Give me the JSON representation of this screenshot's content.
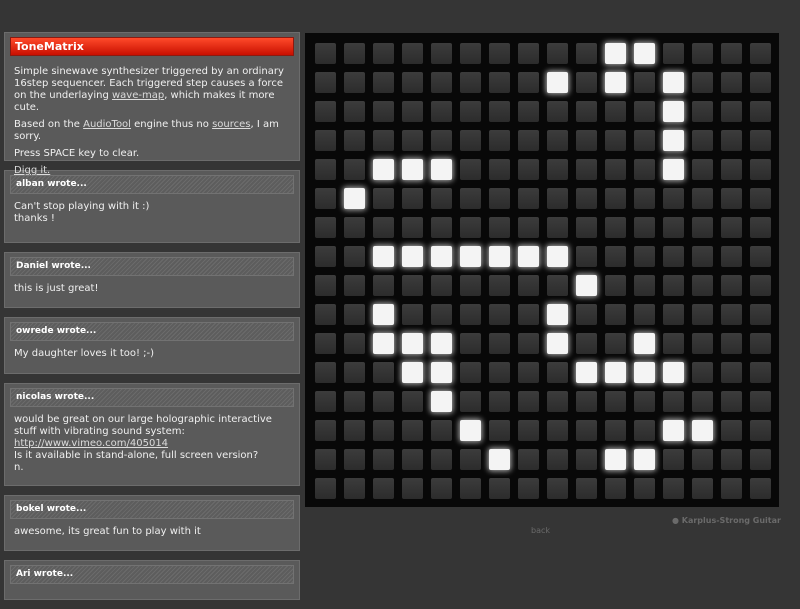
{
  "intro": {
    "title": "ToneMatrix",
    "line1_a": "Simple sinewave synthesizer triggered by an ordinary 16step sequencer. Each triggered step causes a force on the underlaying ",
    "line1_link": "wave-map",
    "line1_b": ", which makes it more cute.",
    "line2_a": "Based on the ",
    "line2_link1": "AudioTool",
    "line2_b": " engine thus no ",
    "line2_link2": "sources",
    "line2_c": ", I am sorry.",
    "line3": "Press SPACE key to clear.",
    "digg": "Digg it."
  },
  "comments": [
    {
      "author": "alban wrote...",
      "lines": [
        "Can't stop playing with it :)",
        "thanks !"
      ]
    },
    {
      "author": "Daniel wrote...",
      "lines": [
        "this is just great!"
      ]
    },
    {
      "author": "owrede wrote...",
      "lines": [
        "My daughter loves it too! ;-)"
      ]
    },
    {
      "author": "nicolas wrote...",
      "lines": [
        "would be great on our large holographic interactive stuff with vibrating sound system:"
      ],
      "link": "http://www.vimeo.com/405014",
      "lines2": [
        "Is it available in stand-alone, full screen version?",
        "n."
      ]
    },
    {
      "author": "bokel wrote...",
      "lines": [
        "awesome, its great fun to play with it"
      ]
    },
    {
      "author": "Ari wrote...",
      "lines": []
    }
  ],
  "matrix": {
    "size": 16,
    "active": [
      [
        0,
        10
      ],
      [
        0,
        11
      ],
      [
        1,
        8
      ],
      [
        1,
        10
      ],
      [
        1,
        12
      ],
      [
        2,
        12
      ],
      [
        3,
        12
      ],
      [
        4,
        2
      ],
      [
        4,
        3
      ],
      [
        4,
        4
      ],
      [
        4,
        12
      ],
      [
        5,
        1
      ],
      [
        7,
        2
      ],
      [
        7,
        3
      ],
      [
        7,
        4
      ],
      [
        7,
        5
      ],
      [
        7,
        6
      ],
      [
        7,
        7
      ],
      [
        7,
        8
      ],
      [
        8,
        9
      ],
      [
        9,
        2
      ],
      [
        9,
        8
      ],
      [
        10,
        2
      ],
      [
        10,
        3
      ],
      [
        10,
        4
      ],
      [
        10,
        8
      ],
      [
        10,
        11
      ],
      [
        11,
        3
      ],
      [
        11,
        4
      ],
      [
        11,
        9
      ],
      [
        11,
        10
      ],
      [
        11,
        11
      ],
      [
        11,
        12
      ],
      [
        12,
        4
      ],
      [
        13,
        5
      ],
      [
        13,
        12
      ],
      [
        13,
        13
      ],
      [
        14,
        6
      ],
      [
        14,
        10
      ],
      [
        14,
        11
      ]
    ]
  },
  "footer": {
    "credit": "● Karplus-Strong Guitar",
    "back": "back"
  }
}
